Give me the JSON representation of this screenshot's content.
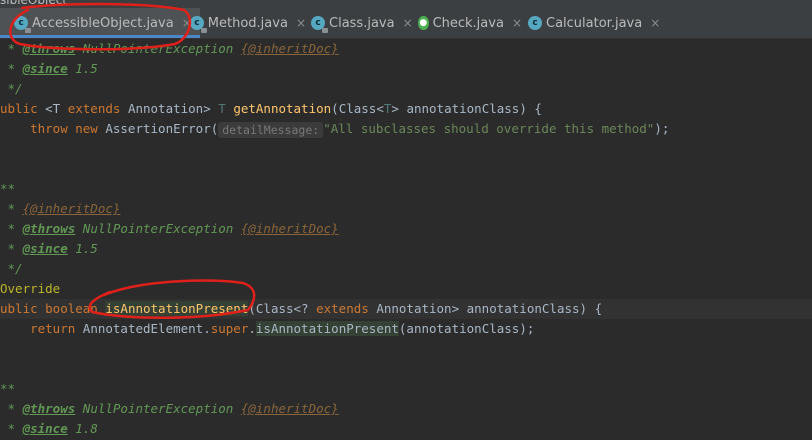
{
  "window": {
    "title_fragment": "sibleObject"
  },
  "tabs": [
    {
      "label": "AccessibleObject.java",
      "icon": "class-icon",
      "active": true
    },
    {
      "label": "Method.java",
      "icon": "class-icon",
      "active": false
    },
    {
      "label": "Class.java",
      "icon": "class-icon",
      "active": false
    },
    {
      "label": "Check.java",
      "icon": "java-file-icon",
      "active": false
    },
    {
      "label": "Calculator.java",
      "icon": "class-icon",
      "active": false
    }
  ],
  "tab_close_glyph": "×",
  "code": {
    "l1": {
      "a": " * ",
      "b": "@throws",
      "c": " NullPointerException ",
      "d": "{@inheritDoc}"
    },
    "l2": {
      "a": " * ",
      "b": "@since",
      "c": " 1.5"
    },
    "l3": {
      "a": " */"
    },
    "l4": {
      "a": "ublic ",
      "b": "<T ",
      "c": "extends",
      "d": " Annotation> ",
      "e": "T",
      "f": " ",
      "g": "getAnnotation",
      "h": "(Class<",
      "i": "T",
      "j": "> annotationClass) {"
    },
    "l5": {
      "a": "    throw new ",
      "b": "AssertionError(",
      "hint": "detailMessage:",
      "str": "\"All subclasses should override this method\"",
      "end": ");"
    },
    "l6": {
      "a": ""
    },
    "l7": {
      "a": ""
    },
    "l8": {
      "a": "**"
    },
    "l9": {
      "a": " * ",
      "b": "{@inheritDoc}"
    },
    "l10": {
      "a": " * ",
      "b": "@throws",
      "c": " NullPointerException ",
      "d": "{@inheritDoc}"
    },
    "l11": {
      "a": " * ",
      "b": "@since",
      "c": " 1.5"
    },
    "l12": {
      "a": " */"
    },
    "l13": {
      "a": "Override"
    },
    "l14": {
      "a": "ublic ",
      "b": "boolean ",
      "c": "isAnnotationPresent",
      "d": "(Class<? ",
      "e": "extends",
      "f": " Annotation> annotationClass) {"
    },
    "l15": {
      "a": "    ",
      "b": "return ",
      "c": "AnnotatedElement.",
      "d": "super",
      "e": ".",
      "f": "isAnnotationPresent",
      "g": "(annotationClass);"
    },
    "l16": {
      "a": ""
    },
    "l17": {
      "a": ""
    },
    "l18": {
      "a": "**"
    },
    "l19": {
      "a": " * ",
      "b": "@throws",
      "c": " NullPointerException ",
      "d": "{@inheritDoc}"
    },
    "l20": {
      "a": " * ",
      "b": "@since",
      "c": " 1.8"
    }
  },
  "colors": {
    "background": "#2b2b2b",
    "keyword": "#cc7832",
    "method": "#ffc66d",
    "comment": "#629755",
    "string": "#6a8759",
    "annotation_mark": "#e0201b"
  }
}
